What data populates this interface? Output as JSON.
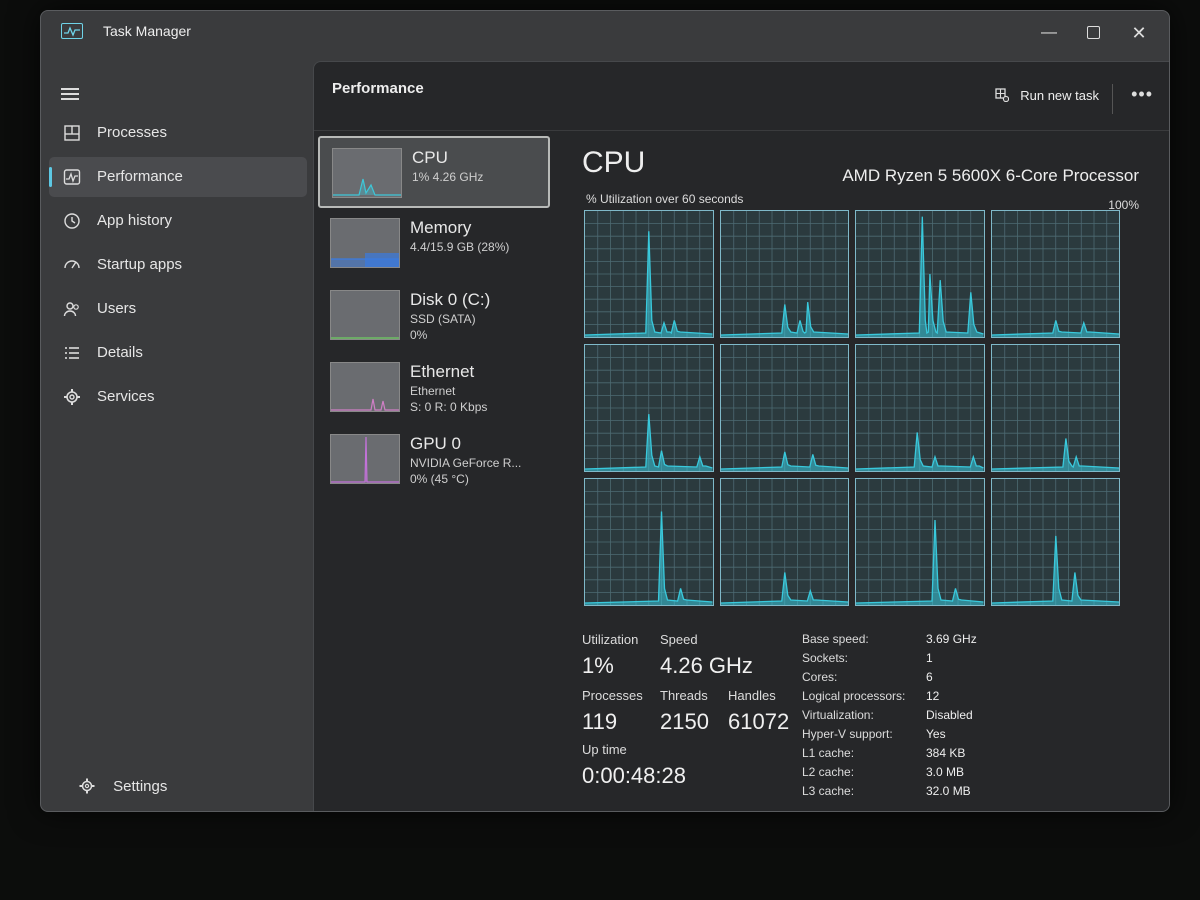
{
  "window": {
    "title": "Task Manager",
    "minimize_glyph": "—",
    "close_glyph": "✕"
  },
  "nav": {
    "items": [
      {
        "label": "Processes",
        "icon": "processes-icon"
      },
      {
        "label": "Performance",
        "icon": "performance-icon",
        "active": true
      },
      {
        "label": "App history",
        "icon": "history-icon"
      },
      {
        "label": "Startup apps",
        "icon": "startup-icon"
      },
      {
        "label": "Users",
        "icon": "users-icon"
      },
      {
        "label": "Details",
        "icon": "details-icon"
      },
      {
        "label": "Services",
        "icon": "services-icon"
      }
    ],
    "settings_label": "Settings"
  },
  "header": {
    "title": "Performance",
    "run_task_label": "Run new task",
    "more_label": "•••"
  },
  "devices": [
    {
      "name": "CPU",
      "sub1": "1% 4.26 GHz",
      "sub2": "",
      "color": "#3ec7d8"
    },
    {
      "name": "Memory",
      "sub1": "4.4/15.9 GB (28%)",
      "sub2": "",
      "color": "#3b7be0"
    },
    {
      "name": "Disk 0 (C:)",
      "sub1": "SSD (SATA)",
      "sub2": "0%",
      "color": "#6fcf62"
    },
    {
      "name": "Ethernet",
      "sub1": "Ethernet",
      "sub2": "S: 0 R: 0 Kbps",
      "color": "#d07fc6"
    },
    {
      "name": "GPU 0",
      "sub1": "NVIDIA GeForce R...",
      "sub2": "0%  (45 °C)",
      "color": "#c272d8"
    }
  ],
  "cpu": {
    "title": "CPU",
    "model": "AMD Ryzen 5 5600X 6-Core Processor",
    "graph_label": "% Utilization over 60 seconds",
    "graph_max": "100%",
    "line_color": "#39c9dc",
    "cores": [
      {
        "spikes": [
          [
            0.5,
            0.85
          ],
          [
            0.62,
            0.1
          ],
          [
            0.7,
            0.12
          ]
        ]
      },
      {
        "spikes": [
          [
            0.5,
            0.25
          ],
          [
            0.62,
            0.12
          ],
          [
            0.68,
            0.27
          ]
        ]
      },
      {
        "spikes": [
          [
            0.52,
            0.97
          ],
          [
            0.58,
            0.5
          ],
          [
            0.66,
            0.45
          ],
          [
            0.9,
            0.35
          ]
        ]
      },
      {
        "spikes": [
          [
            0.5,
            0.12
          ],
          [
            0.72,
            0.1
          ]
        ]
      },
      {
        "spikes": [
          [
            0.5,
            0.45
          ],
          [
            0.6,
            0.15
          ],
          [
            0.9,
            0.1
          ]
        ]
      },
      {
        "spikes": [
          [
            0.5,
            0.14
          ],
          [
            0.72,
            0.12
          ]
        ]
      },
      {
        "spikes": [
          [
            0.48,
            0.3
          ],
          [
            0.62,
            0.1
          ],
          [
            0.92,
            0.1
          ]
        ]
      },
      {
        "spikes": [
          [
            0.58,
            0.25
          ],
          [
            0.66,
            0.1
          ]
        ]
      },
      {
        "spikes": [
          [
            0.6,
            0.75
          ],
          [
            0.75,
            0.12
          ]
        ]
      },
      {
        "spikes": [
          [
            0.5,
            0.25
          ],
          [
            0.7,
            0.1
          ]
        ]
      },
      {
        "spikes": [
          [
            0.62,
            0.68
          ],
          [
            0.78,
            0.12
          ]
        ]
      },
      {
        "spikes": [
          [
            0.5,
            0.55
          ],
          [
            0.65,
            0.25
          ]
        ]
      }
    ],
    "stats": {
      "utilization_label": "Utilization",
      "utilization": "1%",
      "speed_label": "Speed",
      "speed": "4.26 GHz",
      "processes_label": "Processes",
      "processes": "119",
      "threads_label": "Threads",
      "threads": "2150",
      "handles_label": "Handles",
      "handles": "61072",
      "uptime_label": "Up time",
      "uptime": "0:00:48:28"
    },
    "specs": [
      {
        "k": "Base speed:",
        "v": "3.69 GHz"
      },
      {
        "k": "Sockets:",
        "v": "1"
      },
      {
        "k": "Cores:",
        "v": "6"
      },
      {
        "k": "Logical processors:",
        "v": "12"
      },
      {
        "k": "Virtualization:",
        "v": "Disabled"
      },
      {
        "k": "Hyper-V support:",
        "v": "Yes"
      },
      {
        "k": "L1 cache:",
        "v": "384 KB"
      },
      {
        "k": "L2 cache:",
        "v": "3.0 MB"
      },
      {
        "k": "L3 cache:",
        "v": "32.0 MB"
      }
    ]
  }
}
